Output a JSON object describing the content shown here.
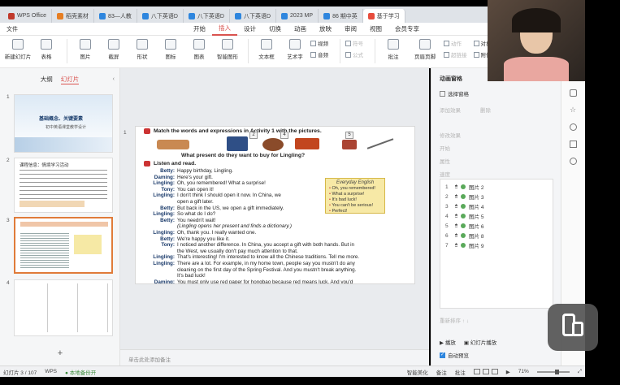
{
  "tabs": [
    {
      "label": "WPS Office",
      "color": "#c0392b"
    },
    {
      "label": "稻壳素材",
      "color": "#e67e22"
    },
    {
      "label": "83—人教",
      "color": "#2e86de"
    },
    {
      "label": "八下英语D",
      "color": "#2e86de"
    },
    {
      "label": "八下英语D",
      "color": "#2e86de"
    },
    {
      "label": "八下英语D",
      "color": "#2e86de"
    },
    {
      "label": "2023 MP",
      "color": "#2e86de"
    },
    {
      "label": "86 期中英",
      "color": "#2e86de"
    },
    {
      "label": "基于学习",
      "color": "#e74c3c"
    }
  ],
  "menu": {
    "file": "文件",
    "items": [
      "开始",
      "插入",
      "设计",
      "切换",
      "动画",
      "放映",
      "审阅",
      "视图",
      "会员专享"
    ],
    "active": "插入"
  },
  "ribbon": {
    "buttons": [
      "新建幻灯片",
      "表格",
      "图片",
      "截屏",
      "形状",
      "图标",
      "图表",
      "智能图形",
      "文本框",
      "艺术字"
    ],
    "small": [
      [
        "视频",
        "音频"
      ],
      [
        "符号",
        "公式"
      ]
    ],
    "right": [
      "批注",
      "页眉页脚",
      "动作",
      "超链接",
      "对象",
      "附件"
    ]
  },
  "left_panel": {
    "tabs": [
      "大纲",
      "幻灯片"
    ],
    "active": "幻灯片",
    "slide_numbers": [
      "1",
      "2",
      "3",
      "4"
    ],
    "thumb1": {
      "title": "基础概念、关键要素",
      "subtitle": "初中英语课堂教学设计"
    },
    "thumb2": {
      "heading": "课程信息：情境学习活动"
    },
    "add_label": "+"
  },
  "slide": {
    "q2": "Match the words and expressions in Activity 1 with the pictures.",
    "badges": [
      "1",
      "2",
      "3",
      "4",
      "5"
    ],
    "question": "What present do they want to buy for Lingling?",
    "q3": "Listen and read.",
    "dialogue": [
      {
        "speaker": "Betty:",
        "line": "Happy birthday, Lingling."
      },
      {
        "speaker": "Daming:",
        "line": "Here's your gift."
      },
      {
        "speaker": "Lingling:",
        "line": "Oh, you remembered! What a surprise!"
      },
      {
        "speaker": "Tony:",
        "line": "You can open it!"
      },
      {
        "speaker": "Lingling:",
        "line": "I don't think I should open it now. In China, we"
      },
      {
        "speaker": "",
        "line": "open a gift later."
      },
      {
        "speaker": "Betty:",
        "line": "But back in the US, we open a gift immediately."
      },
      {
        "speaker": "Lingling:",
        "line": "So what do I do?"
      },
      {
        "speaker": "Betty:",
        "line": "You needn't wait!"
      },
      {
        "speaker": "",
        "line": "(Lingling opens her present and finds a dictionary.)"
      },
      {
        "speaker": "Lingling:",
        "line": "Oh, thank you. I really wanted one."
      },
      {
        "speaker": "Betty:",
        "line": "We're happy you like it."
      },
      {
        "speaker": "Tony:",
        "line": "I noticed another difference. In China, you accept a gift with both hands. But in"
      },
      {
        "speaker": "",
        "line": "the West, we usually don't pay much attention to that."
      },
      {
        "speaker": "Lingling:",
        "line": "That's interesting! I'm interested to know all the Chinese traditions. Tell me more."
      },
      {
        "speaker": "Lingling:",
        "line": "There are a lot. For example, in my home town, people say you mustn't do any"
      },
      {
        "speaker": "",
        "line": "cleaning on the first day of the Spring Festival. And you mustn't break anything."
      },
      {
        "speaker": "",
        "line": "It's bad luck!"
      },
      {
        "speaker": "Daming:",
        "line": "You must only use red paper for hongbao because red means luck. And you'd"
      },
      {
        "speaker": "",
        "line": "better not have your hair cut during the Spring Festival month."
      },
      {
        "speaker": "Tony:",
        "line": "You can't be serious!"
      },
      {
        "speaker": "Daming:",
        "line": "And in the north of China, people eat lots of jiaozi!"
      },
      {
        "speaker": "Betty:",
        "line": "Perfect! They taste great."
      },
      {
        "speaker": "Tony:",
        "line": "I like eating jiaozi too. Anyway, the Spring Festival is still over a month away."
      },
      {
        "speaker": "",
        "line": "Let's celebrate Lingling's birthday first!"
      }
    ],
    "everyday": {
      "title": "Everyday English",
      "items": [
        "Oh, you remembered!",
        "What a surprise!",
        "It's bad luck!",
        "You can't be serious!",
        "Perfect!"
      ]
    }
  },
  "notes_placeholder": "单击此处添加备注",
  "animation_pane": {
    "title": "动画窗格",
    "select_pane": "选择窗格",
    "add_effect": "添加效果",
    "delete": "删除",
    "modify": "修改效果",
    "start": "开始",
    "property": "属性",
    "speed": "速度",
    "items": [
      {
        "num": "1",
        "label": "图片 2"
      },
      {
        "num": "2",
        "label": "图片 3"
      },
      {
        "num": "3",
        "label": "图片 4"
      },
      {
        "num": "4",
        "label": "图片 5"
      },
      {
        "num": "5",
        "label": "图片 6"
      },
      {
        "num": "6",
        "label": "图片 8"
      },
      {
        "num": "7",
        "label": "图片 9"
      }
    ],
    "reorder": "重新排序",
    "play": "播放",
    "slideshow": "幻灯片播放",
    "autopreview": "自动预览"
  },
  "status": {
    "slide": "幻灯片 3 / 107",
    "app": "WPS",
    "backup": "本地备份开",
    "beautify": "智能美化",
    "notes": "备注",
    "comments": "批注",
    "zoom": "71%"
  }
}
